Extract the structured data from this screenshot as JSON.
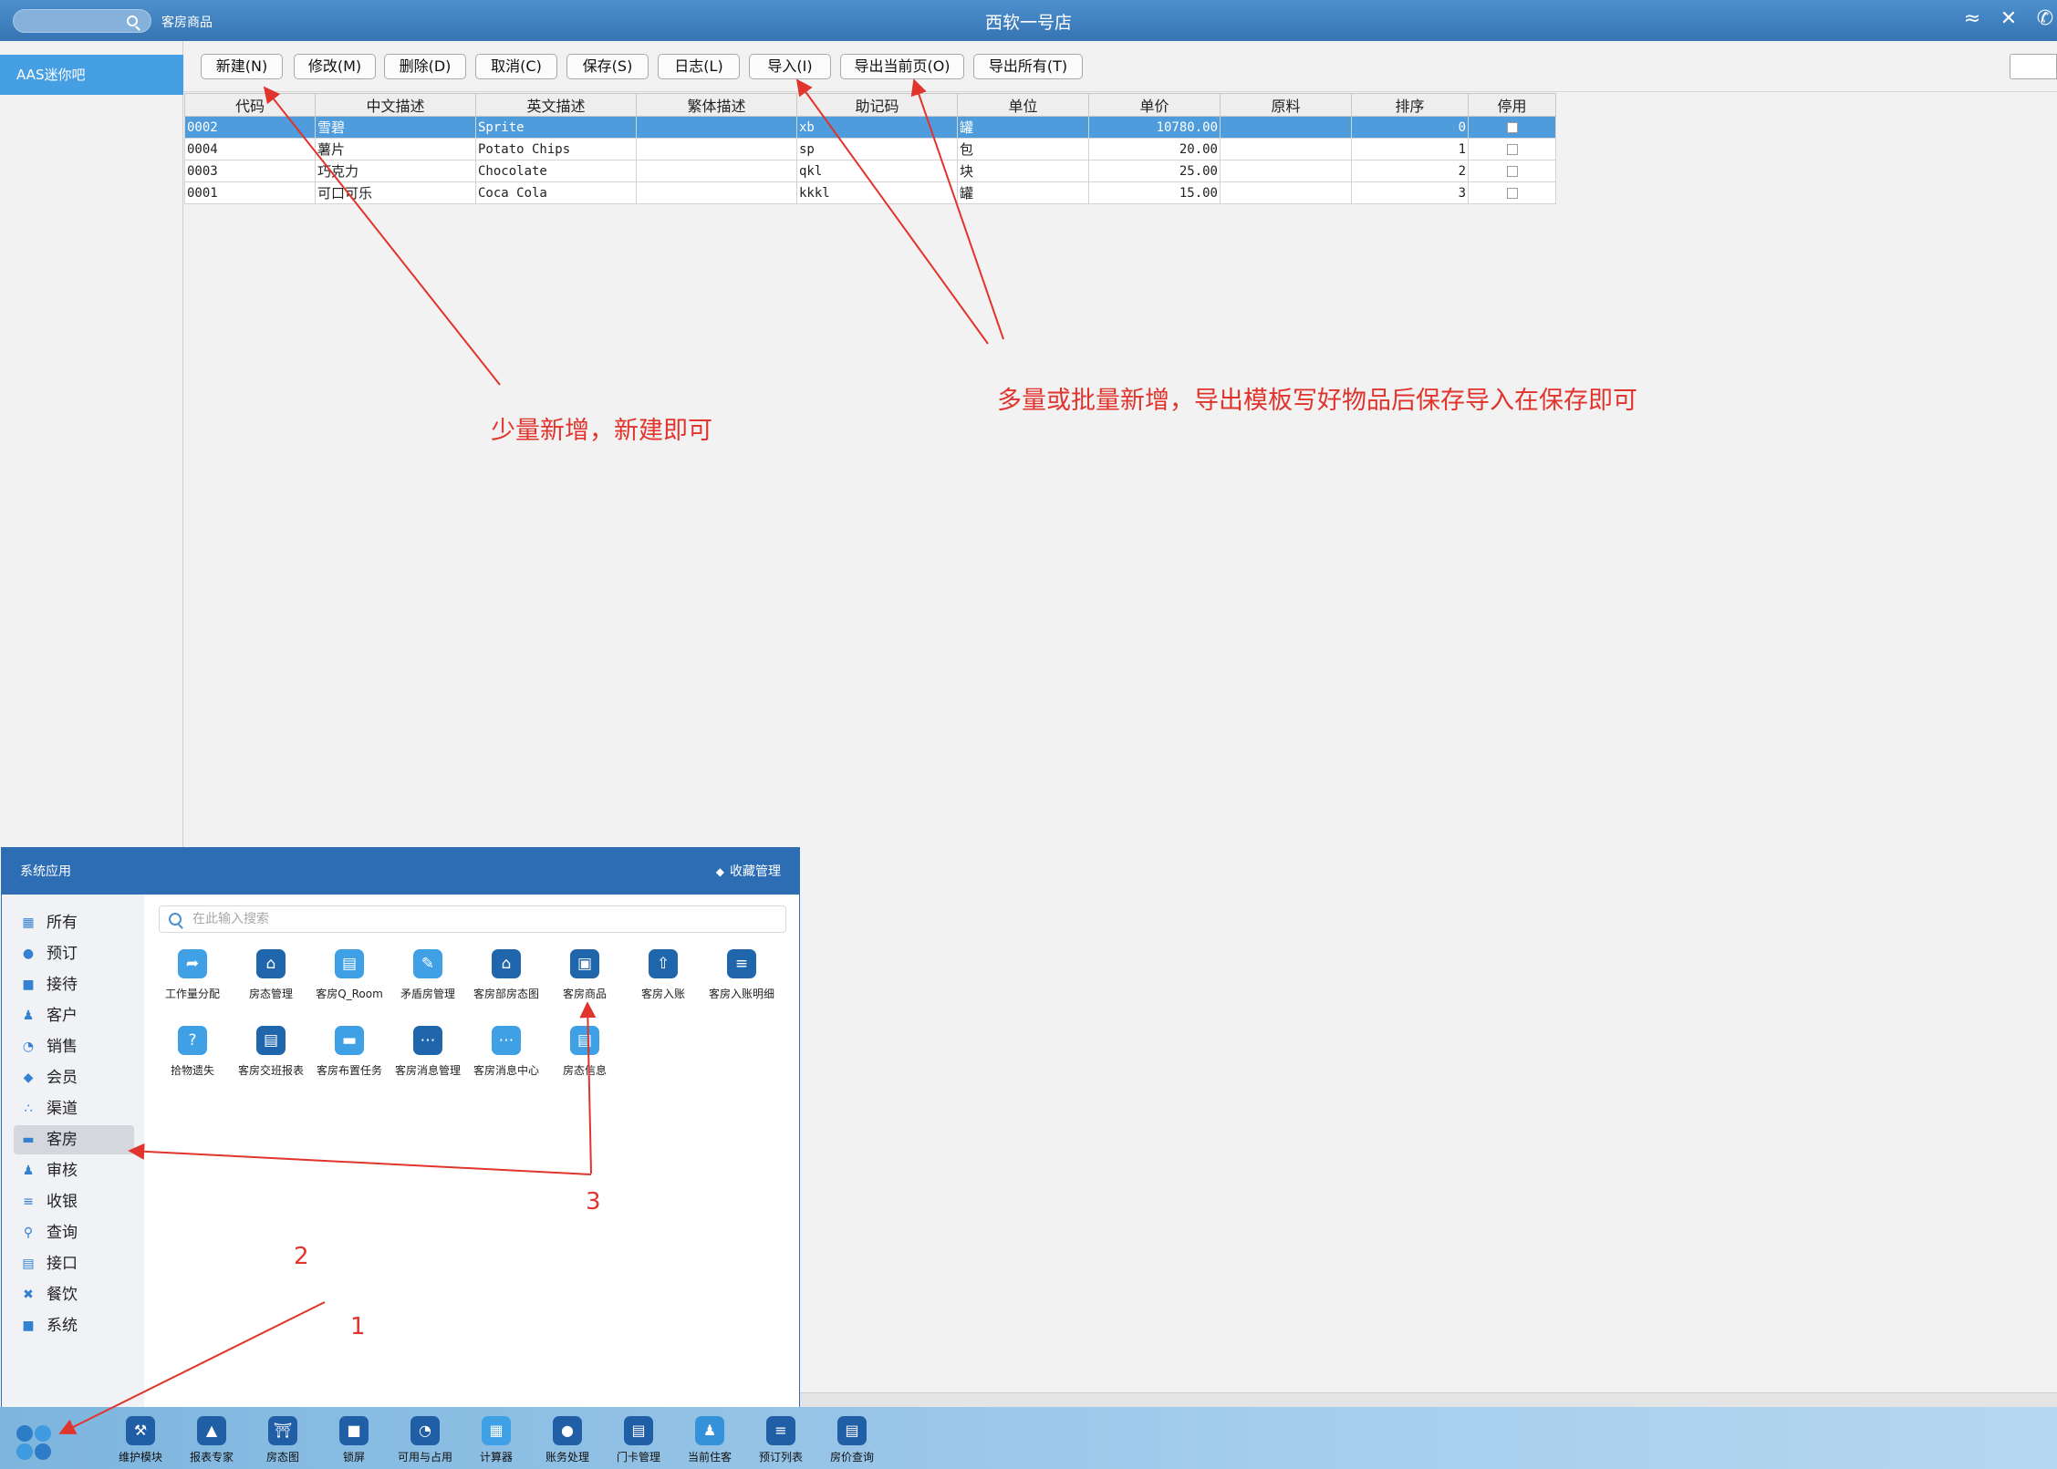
{
  "topbar": {
    "module_label": "客房商品",
    "hotel_name": "西软一号店"
  },
  "left_panel": {
    "selected_item": "AAS迷你吧"
  },
  "toolbar": {
    "buttons": [
      "新建(N)",
      "修改(M)",
      "删除(D)",
      "取消(C)",
      "保存(S)",
      "日志(L)",
      "导入(I)",
      "导出当前页(O)",
      "导出所有(T)"
    ]
  },
  "grid": {
    "columns": [
      "代码",
      "中文描述",
      "英文描述",
      "繁体描述",
      "助记码",
      "单位",
      "单价",
      "原料",
      "排序",
      "停用"
    ],
    "rows": [
      {
        "code": "0002",
        "cn": "雪碧",
        "en": "Sprite",
        "tw": "",
        "mnemonic": "xb",
        "unit": "罐",
        "price": "10780.00",
        "material": "",
        "sort": "0",
        "disabled": false
      },
      {
        "code": "0004",
        "cn": "薯片",
        "en": "Potato Chips",
        "tw": "",
        "mnemonic": "sp",
        "unit": "包",
        "price": "20.00",
        "material": "",
        "sort": "1",
        "disabled": false
      },
      {
        "code": "0003",
        "cn": "巧克力",
        "en": "Chocolate",
        "tw": "",
        "mnemonic": "qkl",
        "unit": "块",
        "price": "25.00",
        "material": "",
        "sort": "2",
        "disabled": false
      },
      {
        "code": "0001",
        "cn": "可口可乐",
        "en": "Coca Cola",
        "tw": "",
        "mnemonic": "kkkl",
        "unit": "罐",
        "price": "15.00",
        "material": "",
        "sort": "3",
        "disabled": false
      }
    ]
  },
  "apps_panel": {
    "title": "系统应用",
    "favorites": "收藏管理",
    "search_placeholder": "在此输入搜索",
    "categories": [
      "所有",
      "预订",
      "接待",
      "客户",
      "销售",
      "会员",
      "渠道",
      "客房",
      "审核",
      "收银",
      "查询",
      "接口",
      "餐饮",
      "系统"
    ],
    "active_category": "客房",
    "apps": [
      "工作量分配",
      "房态管理",
      "客房Q_Room",
      "矛盾房管理",
      "客房部房态图",
      "客房商品",
      "客房入账",
      "客房入账明细",
      "拾物遗失",
      "客房交班报表",
      "客房布置任务",
      "客房消息管理",
      "客房消息中心",
      "房态信息"
    ]
  },
  "taskbar": {
    "items": [
      "维护模块",
      "报表专家",
      "房态图",
      "锁屏",
      "可用与占用",
      "计算器",
      "账务处理",
      "门卡管理",
      "当前住客",
      "预订列表",
      "房价查询"
    ]
  },
  "annotations": {
    "note_single": "少量新增，新建即可",
    "note_bulk": "多量或批量新增，导出模板写好物品后保存导入在保存即可",
    "step1": "1",
    "step2": "2",
    "step3": "3"
  },
  "colors": {
    "header_blue": "#3a7bbf",
    "selected_row": "#4e9cdb",
    "annotation_red": "#e0342d"
  }
}
